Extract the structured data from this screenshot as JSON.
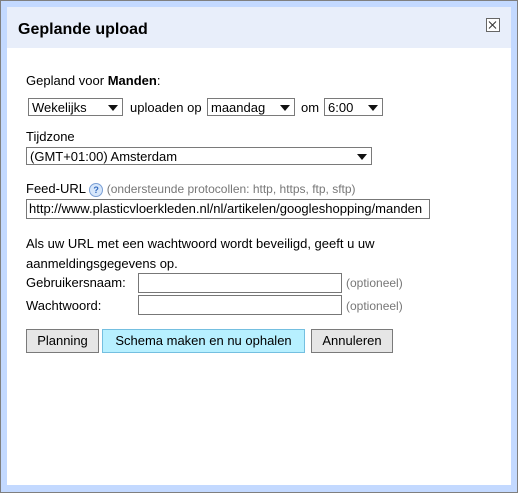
{
  "dialog": {
    "title": "Geplande upload"
  },
  "schedule": {
    "label_prefix": "Gepland voor",
    "feed_name": "Manden",
    "label_suffix": ":",
    "frequency": "Wekelijks",
    "upload_on_label": "uploaden op",
    "day": "maandag",
    "at_label": "om",
    "time": "6:00"
  },
  "timezone": {
    "label": "Tijdzone",
    "value": "(GMT+01:00) Amsterdam"
  },
  "feed_url": {
    "label": "Feed-URL",
    "help_icon": "?",
    "protocols_text": "(ondersteunde protocollen: http, https, ftp, sftp)",
    "value": "http://www.plasticvloerkleden.nl/nl/artikelen/googleshopping/manden"
  },
  "credentials": {
    "note": "Als uw URL met een wachtwoord wordt beveiligd, geeft u uw aanmeldingsgegevens op.",
    "username_label": "Gebruikersnaam:",
    "password_label": "Wachtwoord:",
    "optional_label": "(optioneel)"
  },
  "buttons": {
    "planning": "Planning",
    "schedule_fetch": "Schema maken en nu ophalen",
    "cancel": "Annuleren"
  }
}
